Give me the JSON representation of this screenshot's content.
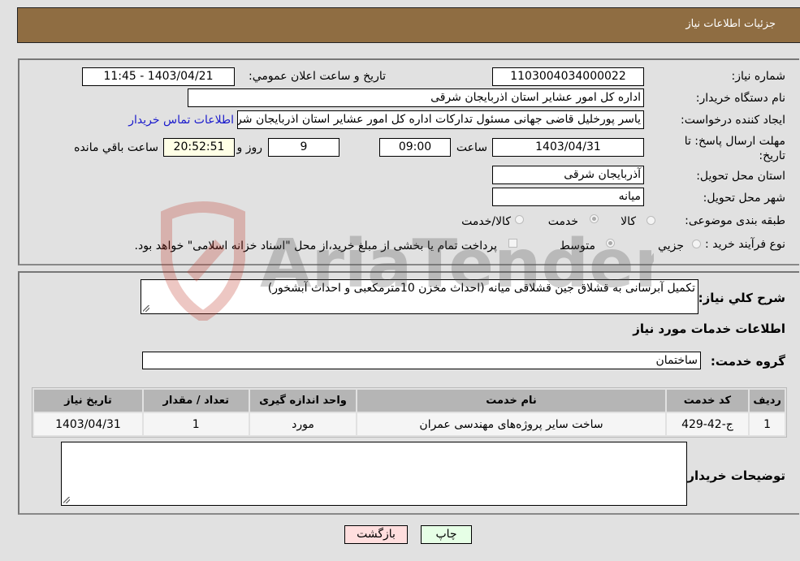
{
  "header": {
    "title": "جزئیات اطلاعات نیاز"
  },
  "form": {
    "need_number": {
      "label": "شماره نیاز:",
      "value": "1103004034000022"
    },
    "announce_datetime": {
      "label": "تاریخ و ساعت اعلان عمومي:",
      "value": "1403/04/21 - 11:45"
    },
    "buyer_org": {
      "label": "نام دستگاه خریدار:",
      "value": "اداره کل امور عشایر استان اذربایجان شرقی"
    },
    "requester": {
      "label": "ایجاد کننده درخواست:",
      "value": "یاسر پورخلیل قاضی جهانی مسئول تدارکات اداره کل امور عشایر استان اذربایجان شرقی",
      "contact_link": "اطلاعات تماس خریدار"
    },
    "deadline": {
      "label": "مهلت ارسال پاسخ: تا تاریخ:",
      "date": "1403/04/31",
      "time_label": "ساعت",
      "time": "09:00",
      "days": "9",
      "days_label": "روز و",
      "remaining": "20:52:51",
      "remaining_label": "ساعت باقي مانده"
    },
    "province": {
      "label": "استان محل تحویل:",
      "value": "آذربایجان شرقی"
    },
    "city": {
      "label": "شهر محل تحویل:",
      "value": "میانه"
    },
    "category": {
      "label": "طبقه بندی موضوعی:",
      "options": [
        "کالا",
        "خدمت",
        "کالا/خدمت"
      ],
      "selected": "خدمت"
    },
    "purchase_type": {
      "label": "نوع فرآیند خرید :",
      "options": [
        "جزیي",
        "متوسط"
      ],
      "selected": "متوسط",
      "treasury_checkbox_label": "پرداخت تمام یا بخشی از مبلغ خرید،از محل \"اسناد خزانه اسلامی\" خواهد بود.",
      "treasury_checked": false
    }
  },
  "details": {
    "description_label": "شرح کلي نیاز:",
    "description": "تکمیل آبرسانی به قشلاق جین قشلاقی میانه (احداث مخزن 10مترمکعبی و احداث آبشخور)",
    "services_title": "اطلاعات خدمات مورد نیاز",
    "service_group_label": "گروه خدمت:",
    "service_group": "ساختمان",
    "table": {
      "headers": [
        "ردیف",
        "کد خدمت",
        "نام خدمت",
        "واحد اندازه گیری",
        "تعداد / مقدار",
        "تاریخ نیاز"
      ],
      "rows": [
        [
          "1",
          "ج-42-429",
          "ساخت سایر پروژه‌های مهندسی عمران",
          "مورد",
          "1",
          "1403/04/31"
        ]
      ]
    },
    "buyer_notes_label": "توضیحات خریدار:",
    "buyer_notes": ""
  },
  "buttons": {
    "print": "چاپ",
    "back": "بازگشت"
  },
  "watermark": {
    "text": "AriaTender.neT"
  }
}
